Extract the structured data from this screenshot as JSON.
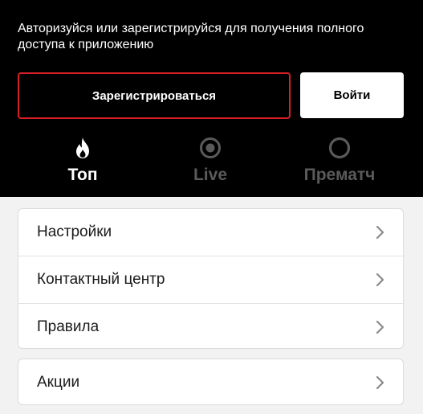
{
  "header": {
    "prompt_text": "Авторизуйся или зарегистрируйся для получения полного доступа к приложению",
    "register_label": "Зарегистрироваться",
    "login_label": "Войти"
  },
  "tabs": [
    {
      "label": "Топ",
      "icon": "flame-icon",
      "active": true
    },
    {
      "label": "Live",
      "icon": "target-icon",
      "active": false
    },
    {
      "label": "Прематч",
      "icon": "circle-icon",
      "active": false
    }
  ],
  "menu": {
    "group1": [
      {
        "label": "Настройки"
      },
      {
        "label": "Контактный центр"
      },
      {
        "label": "Правила"
      }
    ],
    "group2": [
      {
        "label": "Акции"
      }
    ]
  },
  "colors": {
    "header_bg": "#000000",
    "accent_red": "#d61f26",
    "inactive_tab": "#5a5a5a",
    "page_bg": "#f2f2f2"
  }
}
